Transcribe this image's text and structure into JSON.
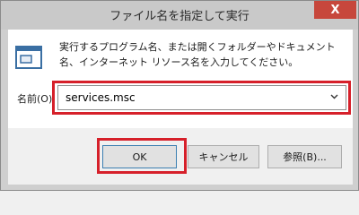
{
  "window": {
    "title": "ファイル名を指定して実行",
    "close_glyph": "X"
  },
  "dialog": {
    "icon": "run-dialog-icon",
    "description": "実行するプログラム名、または開くフォルダーやドキュメント名、インターネット リソース名を入力してください。",
    "open_label": "名前(O):",
    "open_value": "services.msc"
  },
  "buttons": {
    "ok": "OK",
    "cancel": "キャンセル",
    "browse": "参照(B)..."
  },
  "colors": {
    "highlight": "#d6202a",
    "close": "#c7473c"
  }
}
